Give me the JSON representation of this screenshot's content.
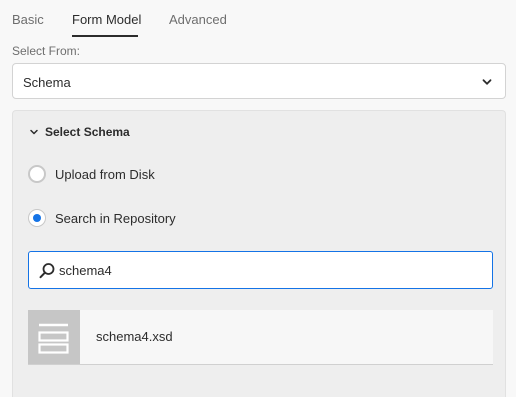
{
  "tabs": [
    {
      "label": "Basic",
      "active": false
    },
    {
      "label": "Form Model",
      "active": true
    },
    {
      "label": "Advanced",
      "active": false
    }
  ],
  "select_from": {
    "label": "Select From:",
    "value": "Schema"
  },
  "schema_section": {
    "title": "Select Schema",
    "expanded": true,
    "options": [
      {
        "label": "Upload from Disk",
        "checked": false
      },
      {
        "label": "Search in Repository",
        "checked": true
      }
    ],
    "search": {
      "value": "schema4",
      "placeholder": ""
    },
    "results": [
      {
        "name": "schema4.xsd",
        "icon": "document-icon"
      }
    ]
  },
  "colors": {
    "accent": "#1473e6",
    "panel_bg": "#eeeeee",
    "thumb_bg": "#c6c6c6"
  }
}
